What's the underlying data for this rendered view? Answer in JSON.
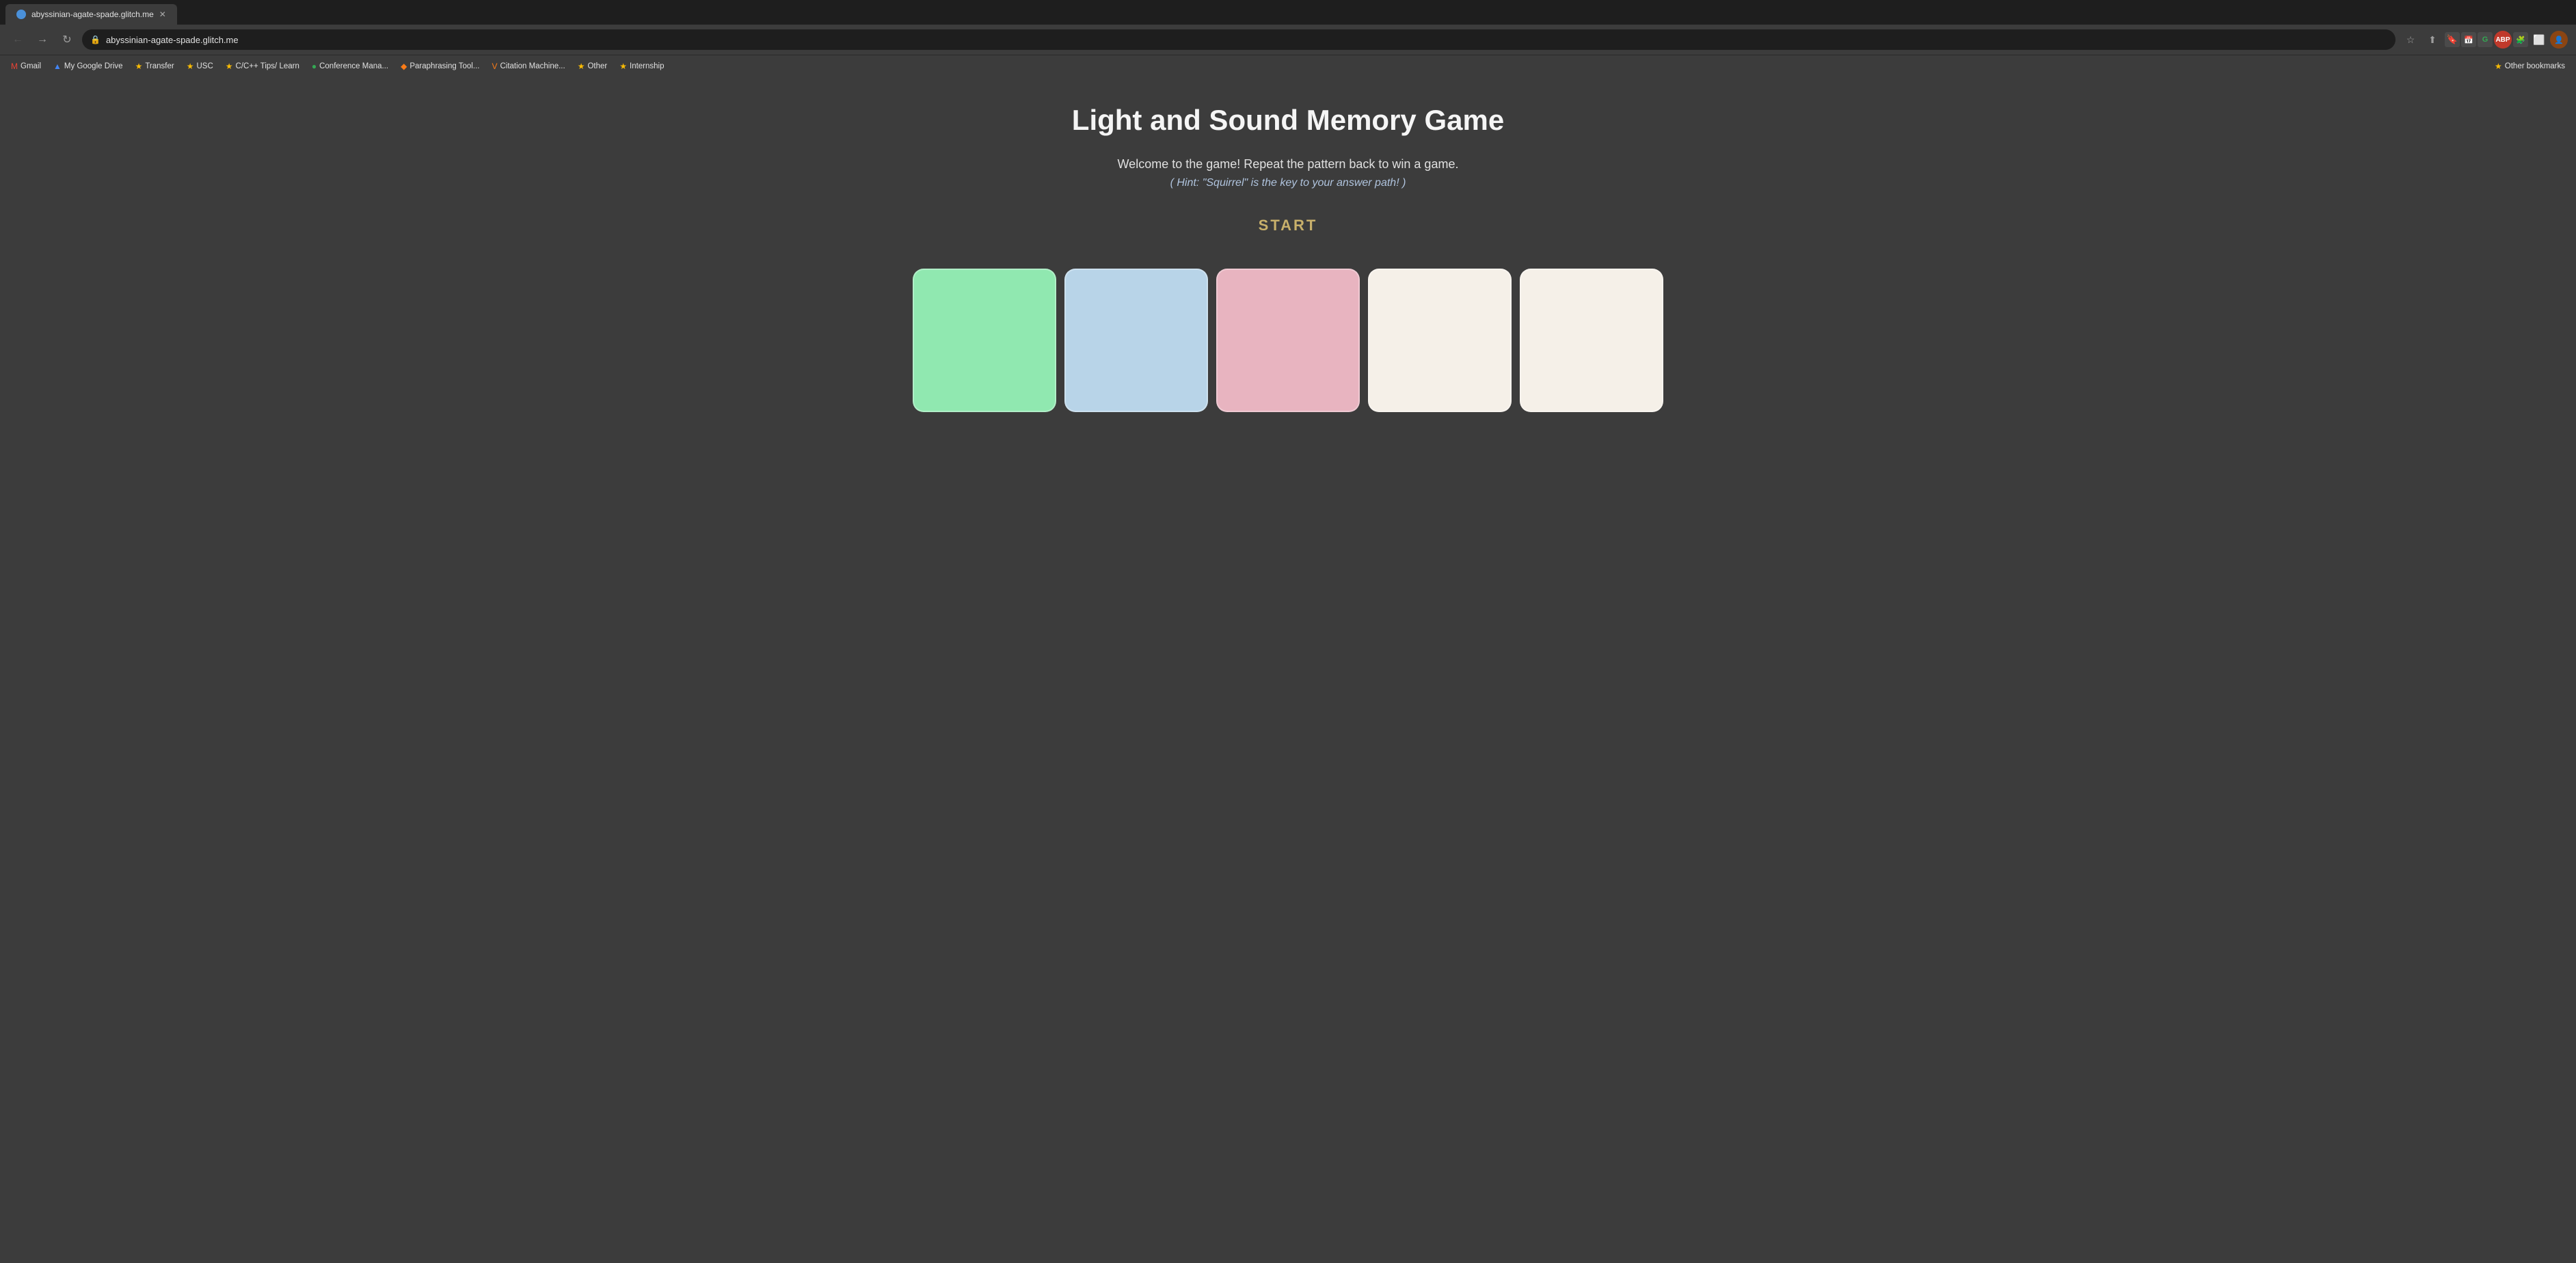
{
  "browser": {
    "tab": {
      "title": "abyssinian-agate-spade.glitch.me",
      "url": "abyssinian-agate-spade.glitch.me"
    },
    "bookmarks": [
      {
        "id": "gmail",
        "label": "Gmail",
        "icon": "M",
        "icon_type": "gmail"
      },
      {
        "id": "google-drive",
        "label": "My Google Drive",
        "icon": "▲",
        "icon_type": "drive"
      },
      {
        "id": "transfer",
        "label": "Transfer",
        "icon": "★",
        "icon_type": "yellow"
      },
      {
        "id": "usc",
        "label": "USC",
        "icon": "★",
        "icon_type": "yellow"
      },
      {
        "id": "cpp-tips",
        "label": "C/C++ Tips/ Learn",
        "icon": "★",
        "icon_type": "yellow"
      },
      {
        "id": "conference",
        "label": "Conference Mana...",
        "icon": "●",
        "icon_type": "green"
      },
      {
        "id": "paraphrasing",
        "label": "Paraphrasing Tool...",
        "icon": "◆",
        "icon_type": "orange"
      },
      {
        "id": "citation",
        "label": "Citation Machine...",
        "icon": "V",
        "icon_type": "orange"
      },
      {
        "id": "other",
        "label": "Other",
        "icon": "★",
        "icon_type": "yellow"
      },
      {
        "id": "internship",
        "label": "Internship",
        "icon": "★",
        "icon_type": "yellow"
      }
    ],
    "other_bookmarks_label": "Other bookmarks"
  },
  "game": {
    "title": "Light and Sound Memory Game",
    "subtitle": "Welcome to the game!   Repeat the pattern back to win a game.",
    "hint": "( Hint: \"Squirrel\" is the key to your answer path! )",
    "start_label": "START",
    "buttons": [
      {
        "id": "btn-green",
        "color": "#90e8b0",
        "class": "btn-green",
        "label": "green button"
      },
      {
        "id": "btn-blue",
        "color": "#b8d4e8",
        "class": "btn-blue",
        "label": "blue button"
      },
      {
        "id": "btn-pink",
        "color": "#e8b4c0",
        "class": "btn-pink",
        "label": "pink button"
      },
      {
        "id": "btn-cream1",
        "color": "#f5f0e8",
        "class": "btn-cream1",
        "label": "cream button 1"
      },
      {
        "id": "btn-cream2",
        "color": "#f5f0e8",
        "class": "btn-cream2",
        "label": "cream button 2"
      }
    ]
  }
}
